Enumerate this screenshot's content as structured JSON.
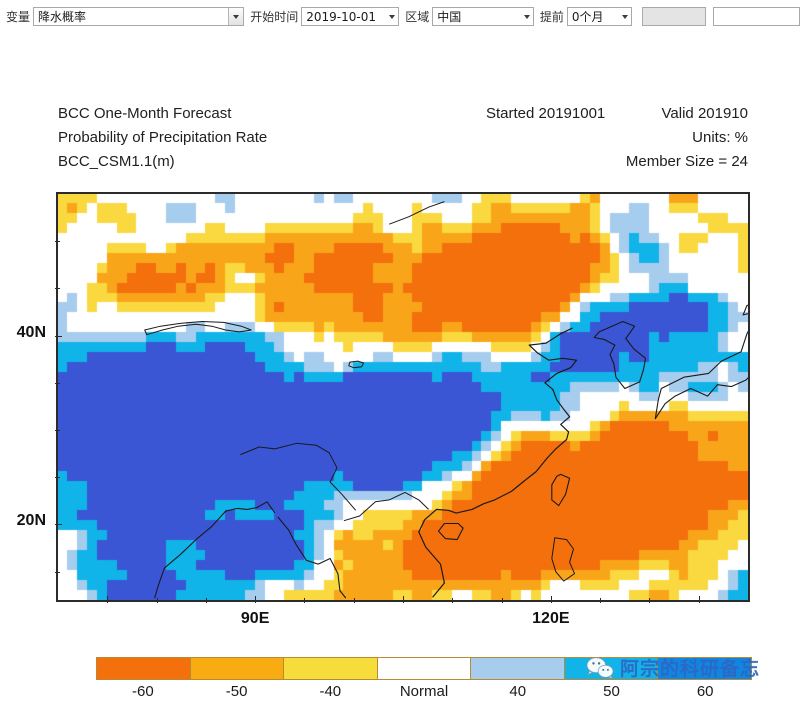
{
  "toolbar": {
    "variable_label": "变量",
    "variable_value": "降水概率",
    "starttime_label": "开始时间",
    "starttime_value": "2019-10-01",
    "region_label": "区域",
    "region_value": "中国",
    "lead_label": "提前",
    "lead_value": "0个月",
    "blank_gray": "",
    "blank_white": ""
  },
  "header": {
    "line1_left": "BCC One-Month Forecast",
    "line1_mid": "Started 20191001",
    "line1_right": "Valid 201910",
    "line2_left": "Probability of Precipitation Rate",
    "line2_right": "Units: %",
    "line3_left": "BCC_CSM1.1(m)",
    "line3_right": "Member Size = 24"
  },
  "watermark": {
    "text": "阿宗的科研备忘",
    "logo": "wechat-icon"
  },
  "chart_data": {
    "type": "heatmap",
    "title": "BCC One-Month Forecast — Probability of Precipitation Rate",
    "subtitle": "BCC_CSM1.1(m)",
    "units": "%",
    "xlabel": "",
    "ylabel": "",
    "xlim": [
      70,
      140
    ],
    "ylim": [
      12,
      55
    ],
    "x_ticks": [
      90,
      120
    ],
    "x_tick_labels": [
      "90E",
      "120E"
    ],
    "y_ticks": [
      20,
      40
    ],
    "y_tick_labels": [
      "20N",
      "40N"
    ],
    "grid": false,
    "grid_nx": 70,
    "grid_ny": 41,
    "legend_position": "bottom",
    "colorbar": {
      "labels": [
        "-60",
        "-50",
        "-40",
        "Normal",
        "40",
        "50",
        "60"
      ],
      "colors": [
        "#f4700c",
        "#f9ab12",
        "#f7dd3c",
        "#ffffff",
        "#a7cdee",
        "#11b4e9",
        "#0f86e0"
      ],
      "bounds": [
        -70,
        -60,
        -50,
        -40,
        40,
        50,
        60,
        70
      ]
    },
    "palette": {
      "deep_orange": "#f4700c",
      "orange": "#f9a51a",
      "yellow": "#f9d93f",
      "white": "#ffffff",
      "light_blue": "#a7cdee",
      "cyan": "#11b4e9",
      "blue": "#3a56d4"
    },
    "description": "Gridded probability-of-precipitation anomaly forecast over China. Negative (orange/yellow) probabilities dominate North China, the Sichuan basin and South China coastal regions; positive (blue/cyan) probabilities dominate the Tibetan Plateau, the Yangtze valley and the Northeast / Sea of Japan area."
  }
}
